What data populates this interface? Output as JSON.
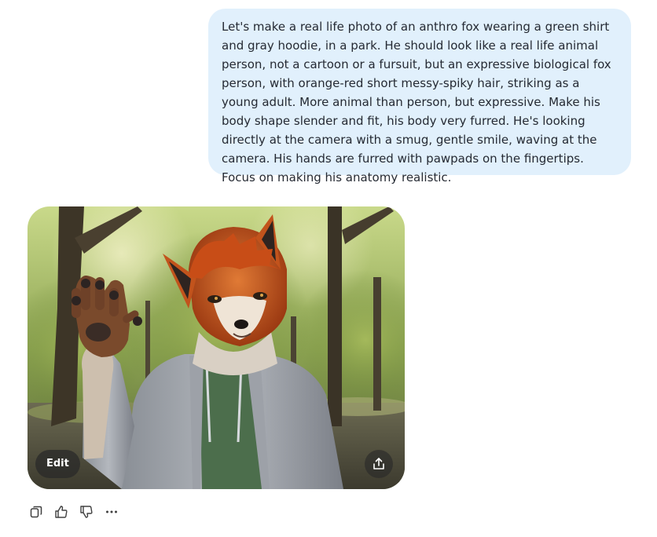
{
  "user_message": {
    "text": "Let's make a real life photo of an anthro fox wearing a green shirt and gray hoodie, in a park. He should look like a real life animal person, not a cartoon or a fursuit, but an expressive biological fox person, with orange-red short messy-spiky hair, striking as a young adult. More animal than person, but expressive. Make his body shape slender and fit, his body very furred. He's looking directly at the camera with a smug, gentle smile, waving at the camera. His hands are furred with pawpads on the fingertips. Focus on making his anatomy realistic."
  },
  "generated_image": {
    "edit_label": "Edit",
    "icons": {
      "share": "share-icon"
    }
  },
  "actions": {
    "icons": [
      "copy-icon",
      "thumbs-up-icon",
      "thumbs-down-icon",
      "more-icon"
    ]
  },
  "colors": {
    "bubble_bg": "#e1f0fc",
    "text": "#252a33",
    "icon": "#404040"
  }
}
